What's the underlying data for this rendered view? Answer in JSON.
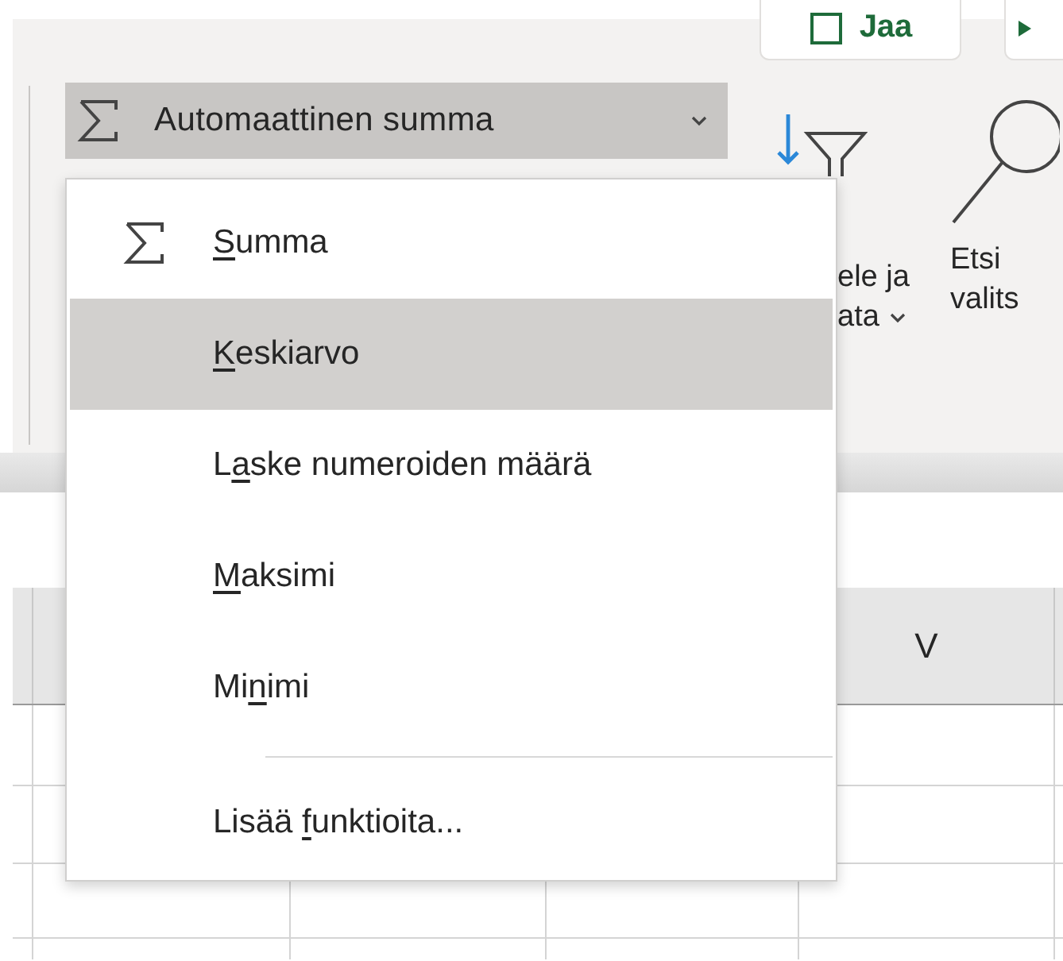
{
  "ribbon": {
    "share_button": {
      "label": "Jaa"
    },
    "autosum_button": {
      "label": "Automaattinen summa",
      "expanded": true
    },
    "sort_filter": {
      "label_line_1": "ele ja",
      "label_line_2": "ata"
    },
    "find_select": {
      "label_line_1": "Etsi",
      "label_line_2": "valits"
    }
  },
  "menu": {
    "items": [
      {
        "kind": "sum_command",
        "access_key": "S",
        "label_after": "umma",
        "selected": false
      },
      {
        "kind": "command",
        "access_key": "K",
        "label_after": "eskiarvo",
        "selected": true
      },
      {
        "kind": "command",
        "label_before": "L",
        "access_key": "a",
        "label_after": "ske numeroiden määrä",
        "selected": false
      },
      {
        "kind": "command",
        "access_key": "M",
        "label_after": "aksimi",
        "selected": false
      },
      {
        "kind": "command",
        "label_before": "Mi",
        "access_key": "n",
        "label_after": "imi",
        "selected": false
      },
      {
        "kind": "separator"
      },
      {
        "kind": "command",
        "label_before": "Lisää ",
        "access_key": "f",
        "label_after": "unktioita...",
        "selected": false
      }
    ]
  },
  "sheet": {
    "column_header": "V"
  }
}
